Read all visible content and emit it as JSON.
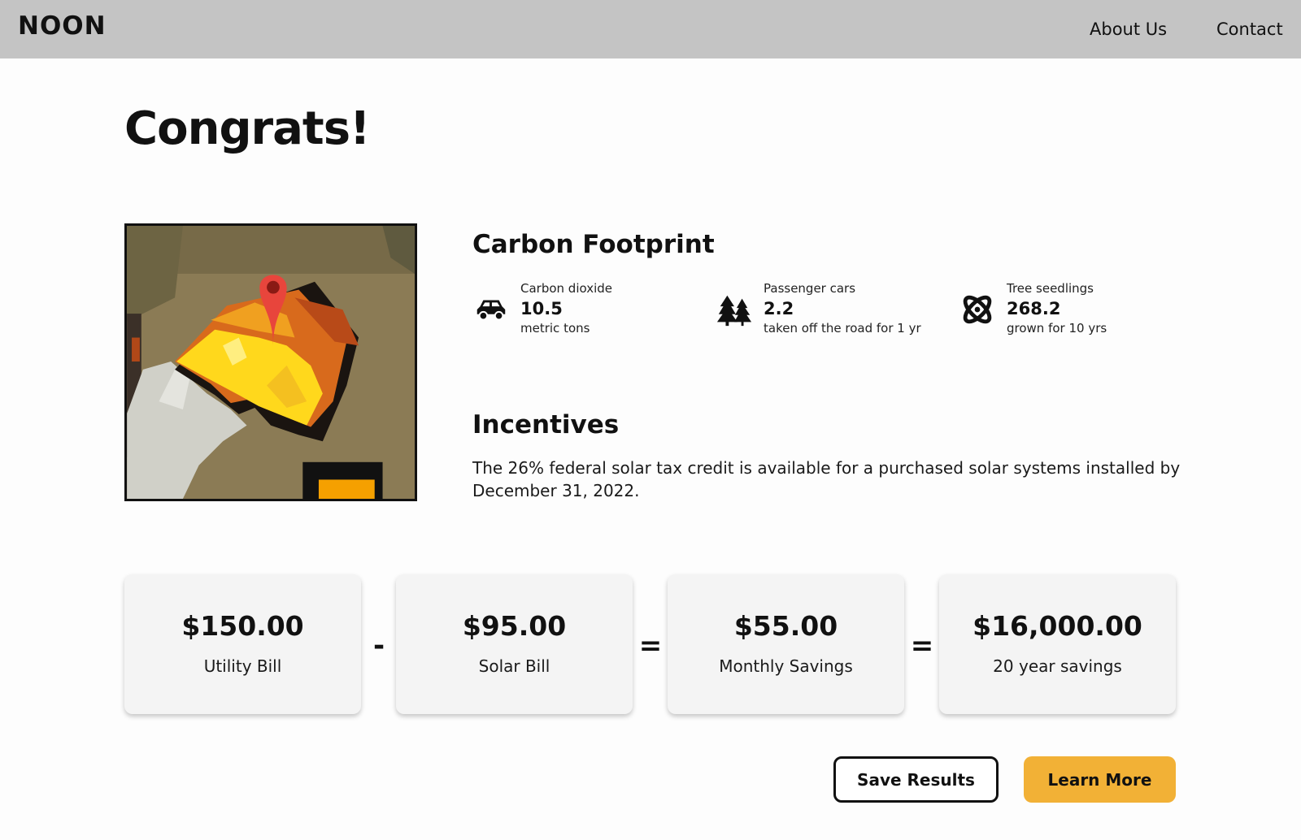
{
  "header": {
    "logo": "NOON",
    "nav": {
      "about": "About Us",
      "contact": "Contact"
    }
  },
  "main": {
    "title": "Congrats!",
    "carbon": {
      "title": "Carbon Footprint",
      "metrics": [
        {
          "label": "Carbon dioxide",
          "value": "10.5",
          "desc": "metric tons",
          "icon": "car-icon"
        },
        {
          "label": "Passenger cars",
          "value": "2.2",
          "desc": "taken off the road for 1 yr",
          "icon": "trees-icon"
        },
        {
          "label": "Tree seedlings",
          "value": "268.2",
          "desc": "grown for 10 yrs",
          "icon": "atom-icon"
        }
      ]
    },
    "incentives": {
      "title": "Incentives",
      "text": "The 26% federal solar tax credit is available for a purchased solar systems installed by December 31, 2022."
    },
    "savings": {
      "cards": [
        {
          "amount": "$150.00",
          "label": "Utility Bill"
        },
        {
          "amount": "$95.00",
          "label": "Solar Bill"
        },
        {
          "amount": "$55.00",
          "label": "Monthly Savings"
        },
        {
          "amount": "$16,000.00",
          "label": "20 year savings"
        }
      ],
      "operators": [
        "-",
        "=",
        "="
      ]
    },
    "actions": {
      "save": "Save Results",
      "learn": "Learn More"
    }
  },
  "colors": {
    "header_bg": "#c4c4c4",
    "accent": "#f2b136",
    "card_bg": "#f4f4f4",
    "pin": "#e8453c"
  }
}
